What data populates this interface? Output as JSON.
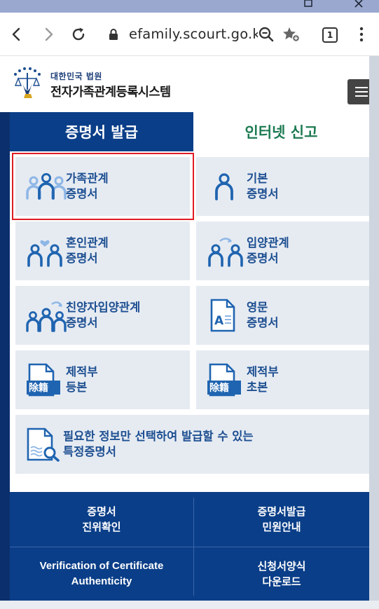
{
  "browser": {
    "url": "efamily.scourt.go.k",
    "tab_count": "1"
  },
  "site": {
    "org_name": "대한민국 법원",
    "system_name": "전자가족관계등록시스템"
  },
  "tabs": [
    {
      "label": "증명서 발급",
      "active": true
    },
    {
      "label": "인터넷 신고",
      "active": false
    }
  ],
  "tiles": [
    {
      "line1": "가족관계",
      "line2": "증명서",
      "icon": "family-icon",
      "selected": true
    },
    {
      "line1": "기본",
      "line2": "증명서",
      "icon": "person-icon"
    },
    {
      "line1": "혼인관계",
      "line2": "증명서",
      "icon": "marriage-icon"
    },
    {
      "line1": "입양관계",
      "line2": "증명서",
      "icon": "adoption-icon"
    },
    {
      "line1": "친양자입양관계",
      "line2": "증명서",
      "icon": "full-adoption-icon"
    },
    {
      "line1": "영문",
      "line2": "증명서",
      "icon": "english-document-icon"
    },
    {
      "line1": "제적부",
      "line2": "등본",
      "icon": "removed-register-icon",
      "badge": "除籍"
    },
    {
      "line1": "제적부",
      "line2": "초본",
      "icon": "removed-register-icon",
      "badge": "除籍"
    },
    {
      "line1": "필요한 정보만 선택하여 발급할 수 있는",
      "line2": "특정증명서",
      "icon": "document-search-icon"
    }
  ],
  "footer": [
    {
      "line1": "증명서",
      "line2": "진위확인"
    },
    {
      "line1": "증명서발급",
      "line2": "민원안내"
    },
    {
      "line1": "Verification of Certificate",
      "line2": "Authenticity"
    },
    {
      "line1": "신청서양식",
      "line2": "다운로드"
    }
  ],
  "colors": {
    "navy": "#0b2f6c",
    "tab_blue": "#0a3e88",
    "tile_bg": "#e6ebf2",
    "tile_text": "#1d4f91",
    "icon_blue": "#1f64b0",
    "icon_light": "#8db6e6",
    "tab_green": "#1d7a52",
    "selected_red": "#e01b24"
  }
}
